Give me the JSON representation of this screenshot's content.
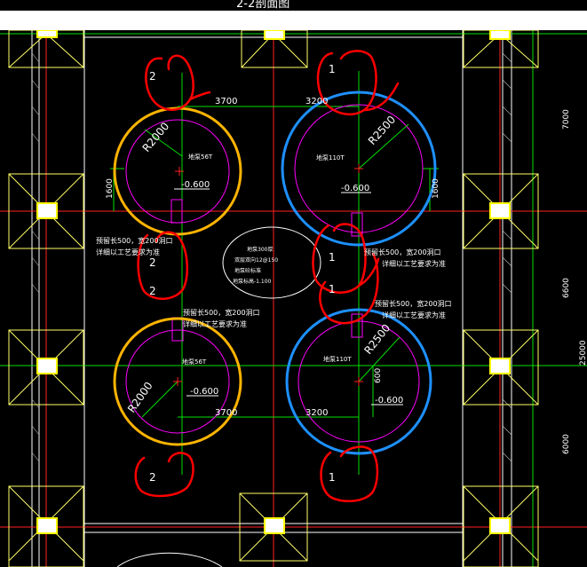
{
  "title": "2-2剖面图",
  "dimensions": {
    "top_left": "3700",
    "top_right": "3200",
    "bottom_left": "3700",
    "bottom_right": "3200",
    "left_vertical": "1600",
    "right_vertical": "1600",
    "right_center_vertical": "600",
    "right_edge_1": "7000",
    "right_edge_2": "6600",
    "right_edge_3": "6000",
    "right_edge_total": "25000"
  },
  "radii": {
    "top_left": "R2000",
    "top_right": "R2500",
    "bottom_left": "R2000",
    "bottom_right": "R2500"
  },
  "pit_labels": {
    "top_left": "地泵56T",
    "top_right": "地泵110T",
    "bottom_left": "地泵56T",
    "bottom_right": "地泵110T"
  },
  "elevations": {
    "top_left": "-0.600",
    "top_right": "-0.600",
    "bottom_left": "-0.600",
    "bottom_right": "-0.600"
  },
  "notes": {
    "left_upper_1": "预留长500，宽200洞口",
    "left_upper_2": "详细以工艺要求为准",
    "left_lower_1": "预留长500，宽200洞口",
    "left_lower_2": "详细以工艺要求为准",
    "right_upper_1": "预留长500，宽200洞口",
    "right_upper_2": "详细以工艺要求为准",
    "right_lower_1": "预留长500，宽200洞口",
    "right_lower_2": "详细以工艺要求为准"
  },
  "center_note": {
    "line1": "地泵300厚",
    "line2": "双层双向12@150",
    "line3": "地泵砼标准",
    "line4": "地泵标高-1.100"
  },
  "markers": {
    "top_left": "2",
    "top_right": "1",
    "mid_left_1": "2",
    "mid_left_2": "2",
    "mid_right_1": "1",
    "mid_right_2": "1",
    "bottom_left": "2",
    "bottom_right": "1"
  },
  "colors": {
    "background": "#000000",
    "grid_red": "#ff2020",
    "grid_green": "#00e000",
    "ring_orange": "#ffb400",
    "ring_blue": "#1e90ff",
    "inner_magenta": "#ff00ff",
    "structure_yellow": "#ffff66",
    "markup_red": "#ff0000"
  }
}
